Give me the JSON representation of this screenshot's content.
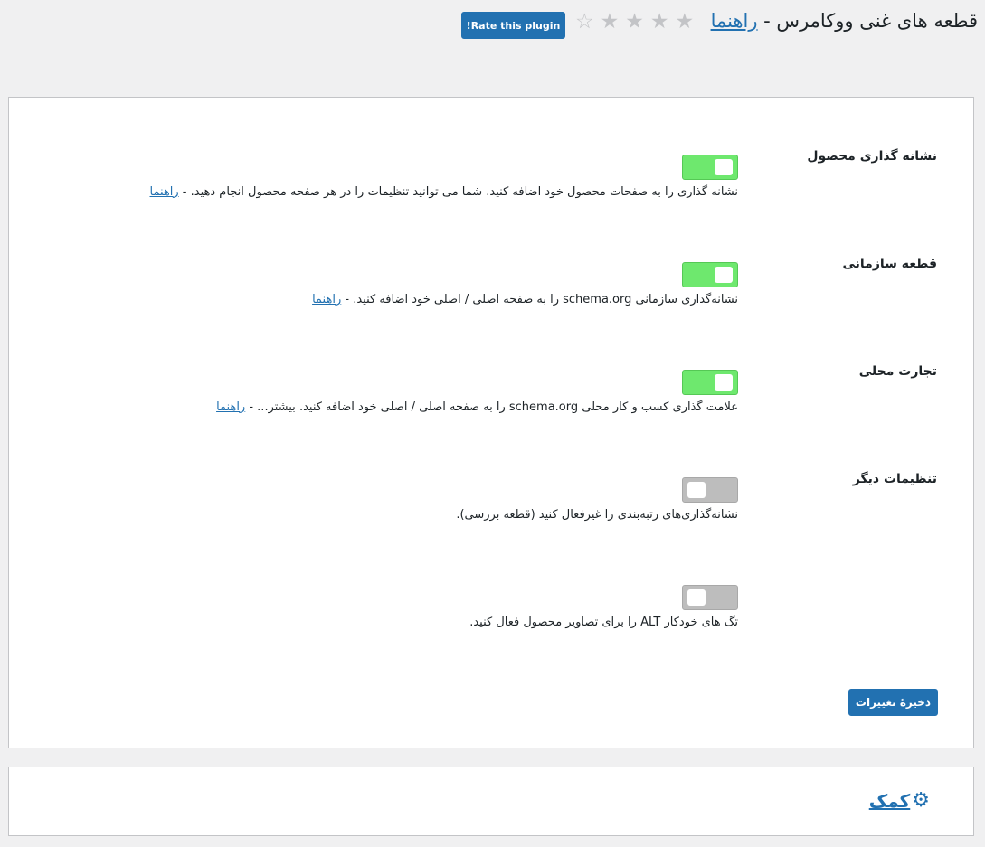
{
  "header": {
    "title": "قطعه های غنی ووکامرس - ",
    "title_link": "راهنما",
    "stars": [
      "☆",
      "★",
      "★",
      "★",
      "★"
    ],
    "rate_button": "Rate this plugin!"
  },
  "settings": [
    {
      "label": "نشانه گذاری محصول",
      "toggle": "on",
      "description": "نشانه گذاری را به صفحات محصول خود اضافه کنید. شما می توانید تنظیمات را در هر صفحه محصول انجام دهید. - ",
      "link": "راهنما"
    },
    {
      "label": "قطعه سازمانی",
      "toggle": "on",
      "description": "نشانه‌گذاری سازمانی schema.org را به صفحه اصلی / اصلی خود اضافه کنید. - ",
      "link": "راهنما"
    },
    {
      "label": "تجارت محلی",
      "toggle": "on",
      "description": "علامت گذاری کسب و کار محلی schema.org را به صفحه اصلی / اصلی خود اضافه کنید. بیشتر... - ",
      "link": "راهنما"
    },
    {
      "label": "تنظیمات دیگر",
      "toggle": "off",
      "description": "نشانه‌گذاری‌های رتبه‌بندی را غیرفعال کنید (قطعه بررسی).",
      "link": ""
    },
    {
      "label": "",
      "toggle": "off",
      "description": "تگ های خودکار ALT را برای تصاویر محصول فعال کنید.",
      "link": ""
    }
  ],
  "save_button": "ذخیرهٔ تغییرات",
  "help": {
    "title": "کمک",
    "icon": "gear-icon"
  },
  "colors": {
    "primary": "#2271b1",
    "toggle_on": "#6ee86e",
    "toggle_off": "#bdbdbd",
    "star": "#c3c4c7"
  }
}
